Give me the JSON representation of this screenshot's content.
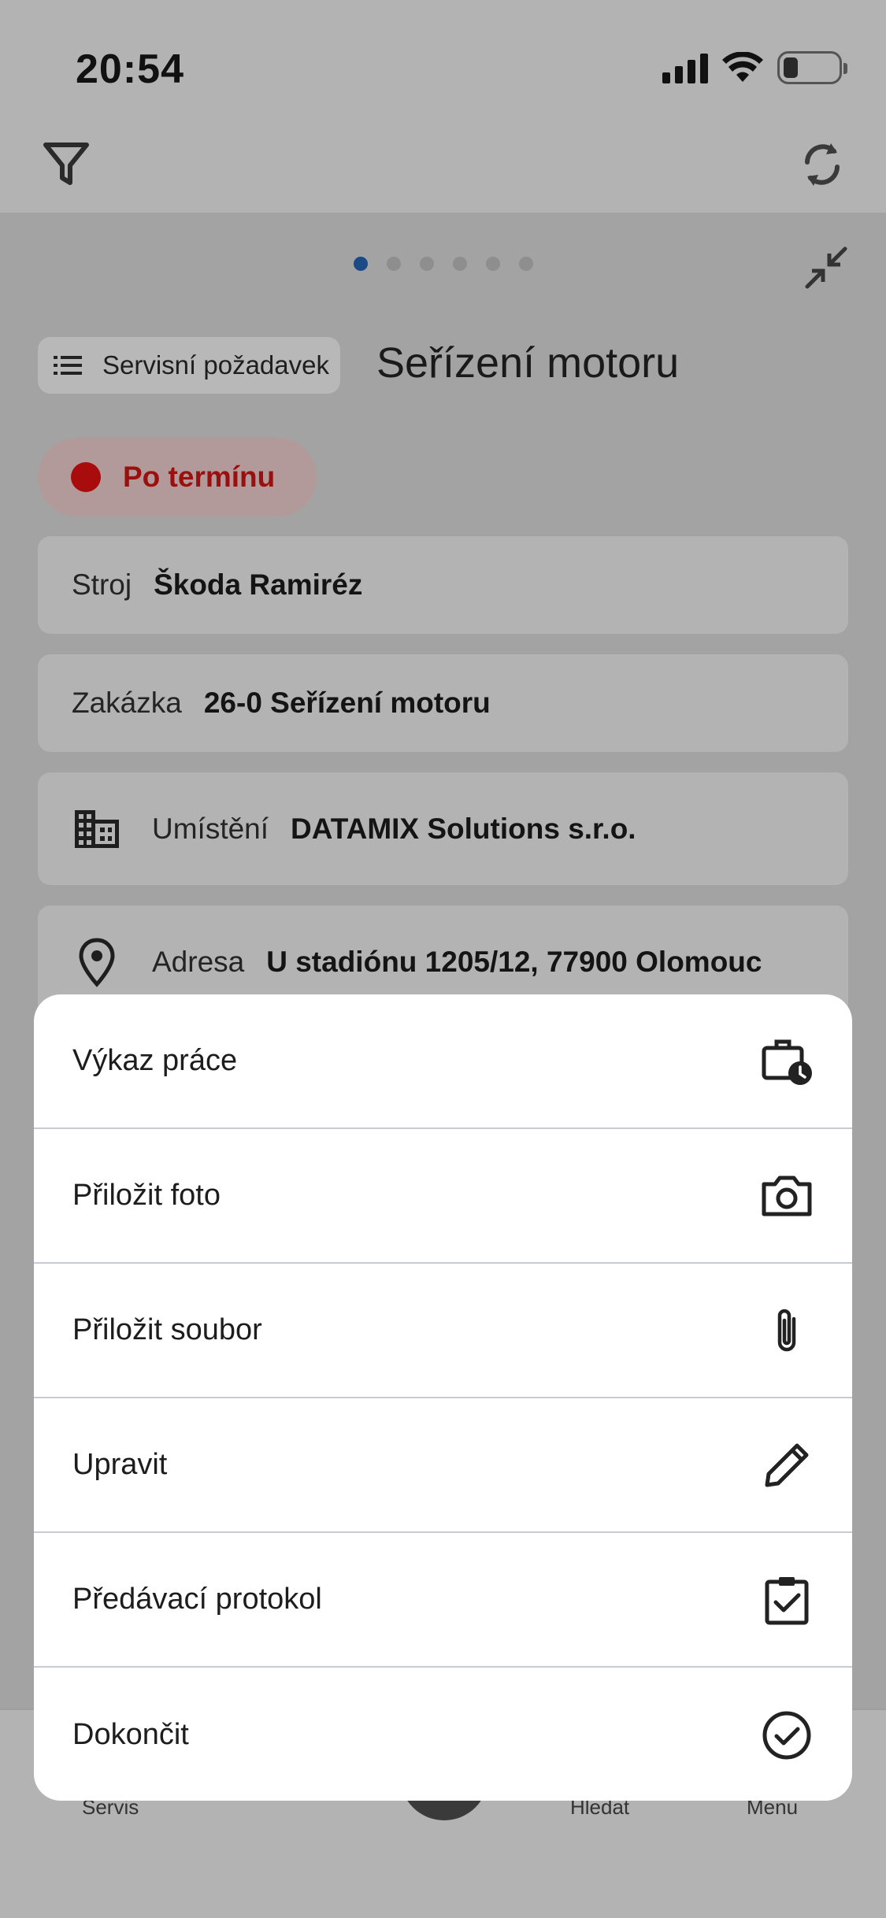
{
  "status_bar": {
    "time": "20:54",
    "icons": [
      "cellular-signal-icon",
      "wifi-icon",
      "battery-icon"
    ]
  },
  "toolbar": {
    "left_icon": "filter-icon",
    "right_icon": "sync-icon"
  },
  "pager": {
    "count": 6,
    "active_index": 0
  },
  "detail": {
    "type_chip_label": "Servisní požadavek",
    "title": "Seřízení motoru",
    "status_label": "Po termínu",
    "status_color": "#a80c0c",
    "fields": [
      {
        "label": "Stroj",
        "value": "Škoda Ramiréz",
        "icon": null
      },
      {
        "label": "Zakázka",
        "value": "26-0 Seřízení motoru",
        "icon": null
      },
      {
        "label": "Umístění",
        "value": "DATAMIX Solutions s.r.o.",
        "icon": "building-icon"
      },
      {
        "label": "Adresa",
        "value": "U stadiónu 1205/12, 77900 Olomouc",
        "icon": "location-pin-icon"
      }
    ]
  },
  "bottom_nav": {
    "items": [
      "Servis",
      "Hledat",
      "Menu"
    ]
  },
  "action_sheet": {
    "items": [
      {
        "label": "Výkaz práce",
        "icon": "work-report-icon"
      },
      {
        "label": "Přiložit foto",
        "icon": "camera-icon"
      },
      {
        "label": "Přiložit soubor",
        "icon": "paperclip-icon"
      },
      {
        "label": "Upravit",
        "icon": "pencil-icon"
      },
      {
        "label": "Předávací protokol",
        "icon": "clipboard-check-icon"
      },
      {
        "label": "Dokončit",
        "icon": "check-circle-icon"
      }
    ]
  },
  "colors": {
    "accent_dot": "#1c4a86",
    "scrim_background": "#a3a3a3",
    "sheet_background": "#ffffff"
  }
}
